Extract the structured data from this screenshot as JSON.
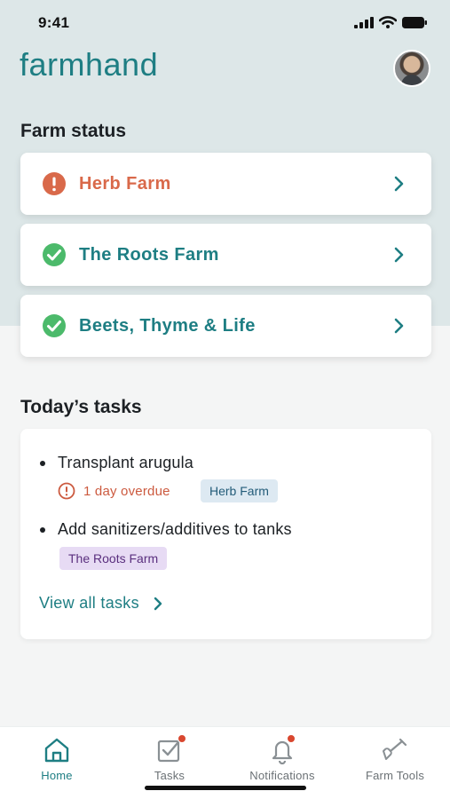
{
  "status_bar": {
    "time": "9:41"
  },
  "app": {
    "name": "farmhand"
  },
  "farm_status": {
    "title": "Farm status",
    "farms": [
      {
        "name": "Herb Farm",
        "status": "alert",
        "color": "#d9694a"
      },
      {
        "name": "The Roots Farm",
        "status": "ok",
        "color": "#1e7e83"
      },
      {
        "name": "Beets, Thyme & Life",
        "status": "ok",
        "color": "#1e7e83"
      }
    ]
  },
  "tasks": {
    "title": "Today’s tasks",
    "items": [
      {
        "text": "Transplant arugula",
        "overdue": "1 day overdue",
        "farm_tag": "Herb Farm"
      },
      {
        "text": "Add sanitizers/additives to tanks",
        "farm_tag": "The Roots Farm"
      }
    ],
    "view_all": "View all tasks"
  },
  "nav": {
    "items": [
      {
        "label": "Home",
        "icon": "home-icon",
        "active": true
      },
      {
        "label": "Tasks",
        "icon": "tasks-icon",
        "badge": true
      },
      {
        "label": "Notifications",
        "icon": "bell-icon",
        "badge": true
      },
      {
        "label": "Farm Tools",
        "icon": "shovel-icon"
      }
    ]
  },
  "colors": {
    "brand": "#1e7e83",
    "alert": "#d9694a",
    "success": "#4cba6b",
    "header_bg": "#dde7e8",
    "badge": "#d9472f"
  }
}
